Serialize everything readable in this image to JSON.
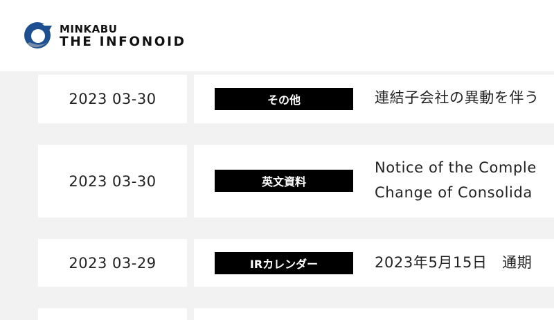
{
  "header": {
    "brand_small": "MINKABU",
    "brand_big": "THE INFONOID",
    "logo_color": "#1d4f91"
  },
  "rows": [
    {
      "date": "2023 03-30",
      "tag": "その他",
      "title_lines": [
        "連結子会社の異動を伴う"
      ]
    },
    {
      "date": "2023 03-30",
      "tag": "英文資料",
      "title_lines": [
        "Notice of the Comple",
        "Change of Consolida"
      ]
    },
    {
      "date": "2023 03-29",
      "tag": "IRカレンダー",
      "title_lines": [
        "2023年5月15日　通期"
      ]
    },
    {
      "date": "",
      "tag": "",
      "title_lines": []
    }
  ]
}
